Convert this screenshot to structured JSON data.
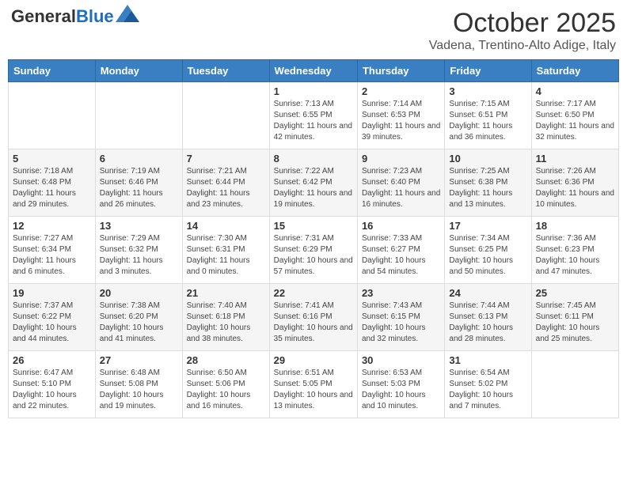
{
  "header": {
    "logo_general": "General",
    "logo_blue": "Blue",
    "month": "October 2025",
    "location": "Vadena, Trentino-Alto Adige, Italy"
  },
  "weekdays": [
    "Sunday",
    "Monday",
    "Tuesday",
    "Wednesday",
    "Thursday",
    "Friday",
    "Saturday"
  ],
  "weeks": [
    [
      {
        "day": "",
        "sunrise": "",
        "sunset": "",
        "daylight": ""
      },
      {
        "day": "",
        "sunrise": "",
        "sunset": "",
        "daylight": ""
      },
      {
        "day": "",
        "sunrise": "",
        "sunset": "",
        "daylight": ""
      },
      {
        "day": "1",
        "sunrise": "Sunrise: 7:13 AM",
        "sunset": "Sunset: 6:55 PM",
        "daylight": "Daylight: 11 hours and 42 minutes."
      },
      {
        "day": "2",
        "sunrise": "Sunrise: 7:14 AM",
        "sunset": "Sunset: 6:53 PM",
        "daylight": "Daylight: 11 hours and 39 minutes."
      },
      {
        "day": "3",
        "sunrise": "Sunrise: 7:15 AM",
        "sunset": "Sunset: 6:51 PM",
        "daylight": "Daylight: 11 hours and 36 minutes."
      },
      {
        "day": "4",
        "sunrise": "Sunrise: 7:17 AM",
        "sunset": "Sunset: 6:50 PM",
        "daylight": "Daylight: 11 hours and 32 minutes."
      }
    ],
    [
      {
        "day": "5",
        "sunrise": "Sunrise: 7:18 AM",
        "sunset": "Sunset: 6:48 PM",
        "daylight": "Daylight: 11 hours and 29 minutes."
      },
      {
        "day": "6",
        "sunrise": "Sunrise: 7:19 AM",
        "sunset": "Sunset: 6:46 PM",
        "daylight": "Daylight: 11 hours and 26 minutes."
      },
      {
        "day": "7",
        "sunrise": "Sunrise: 7:21 AM",
        "sunset": "Sunset: 6:44 PM",
        "daylight": "Daylight: 11 hours and 23 minutes."
      },
      {
        "day": "8",
        "sunrise": "Sunrise: 7:22 AM",
        "sunset": "Sunset: 6:42 PM",
        "daylight": "Daylight: 11 hours and 19 minutes."
      },
      {
        "day": "9",
        "sunrise": "Sunrise: 7:23 AM",
        "sunset": "Sunset: 6:40 PM",
        "daylight": "Daylight: 11 hours and 16 minutes."
      },
      {
        "day": "10",
        "sunrise": "Sunrise: 7:25 AM",
        "sunset": "Sunset: 6:38 PM",
        "daylight": "Daylight: 11 hours and 13 minutes."
      },
      {
        "day": "11",
        "sunrise": "Sunrise: 7:26 AM",
        "sunset": "Sunset: 6:36 PM",
        "daylight": "Daylight: 11 hours and 10 minutes."
      }
    ],
    [
      {
        "day": "12",
        "sunrise": "Sunrise: 7:27 AM",
        "sunset": "Sunset: 6:34 PM",
        "daylight": "Daylight: 11 hours and 6 minutes."
      },
      {
        "day": "13",
        "sunrise": "Sunrise: 7:29 AM",
        "sunset": "Sunset: 6:32 PM",
        "daylight": "Daylight: 11 hours and 3 minutes."
      },
      {
        "day": "14",
        "sunrise": "Sunrise: 7:30 AM",
        "sunset": "Sunset: 6:31 PM",
        "daylight": "Daylight: 11 hours and 0 minutes."
      },
      {
        "day": "15",
        "sunrise": "Sunrise: 7:31 AM",
        "sunset": "Sunset: 6:29 PM",
        "daylight": "Daylight: 10 hours and 57 minutes."
      },
      {
        "day": "16",
        "sunrise": "Sunrise: 7:33 AM",
        "sunset": "Sunset: 6:27 PM",
        "daylight": "Daylight: 10 hours and 54 minutes."
      },
      {
        "day": "17",
        "sunrise": "Sunrise: 7:34 AM",
        "sunset": "Sunset: 6:25 PM",
        "daylight": "Daylight: 10 hours and 50 minutes."
      },
      {
        "day": "18",
        "sunrise": "Sunrise: 7:36 AM",
        "sunset": "Sunset: 6:23 PM",
        "daylight": "Daylight: 10 hours and 47 minutes."
      }
    ],
    [
      {
        "day": "19",
        "sunrise": "Sunrise: 7:37 AM",
        "sunset": "Sunset: 6:22 PM",
        "daylight": "Daylight: 10 hours and 44 minutes."
      },
      {
        "day": "20",
        "sunrise": "Sunrise: 7:38 AM",
        "sunset": "Sunset: 6:20 PM",
        "daylight": "Daylight: 10 hours and 41 minutes."
      },
      {
        "day": "21",
        "sunrise": "Sunrise: 7:40 AM",
        "sunset": "Sunset: 6:18 PM",
        "daylight": "Daylight: 10 hours and 38 minutes."
      },
      {
        "day": "22",
        "sunrise": "Sunrise: 7:41 AM",
        "sunset": "Sunset: 6:16 PM",
        "daylight": "Daylight: 10 hours and 35 minutes."
      },
      {
        "day": "23",
        "sunrise": "Sunrise: 7:43 AM",
        "sunset": "Sunset: 6:15 PM",
        "daylight": "Daylight: 10 hours and 32 minutes."
      },
      {
        "day": "24",
        "sunrise": "Sunrise: 7:44 AM",
        "sunset": "Sunset: 6:13 PM",
        "daylight": "Daylight: 10 hours and 28 minutes."
      },
      {
        "day": "25",
        "sunrise": "Sunrise: 7:45 AM",
        "sunset": "Sunset: 6:11 PM",
        "daylight": "Daylight: 10 hours and 25 minutes."
      }
    ],
    [
      {
        "day": "26",
        "sunrise": "Sunrise: 6:47 AM",
        "sunset": "Sunset: 5:10 PM",
        "daylight": "Daylight: 10 hours and 22 minutes."
      },
      {
        "day": "27",
        "sunrise": "Sunrise: 6:48 AM",
        "sunset": "Sunset: 5:08 PM",
        "daylight": "Daylight: 10 hours and 19 minutes."
      },
      {
        "day": "28",
        "sunrise": "Sunrise: 6:50 AM",
        "sunset": "Sunset: 5:06 PM",
        "daylight": "Daylight: 10 hours and 16 minutes."
      },
      {
        "day": "29",
        "sunrise": "Sunrise: 6:51 AM",
        "sunset": "Sunset: 5:05 PM",
        "daylight": "Daylight: 10 hours and 13 minutes."
      },
      {
        "day": "30",
        "sunrise": "Sunrise: 6:53 AM",
        "sunset": "Sunset: 5:03 PM",
        "daylight": "Daylight: 10 hours and 10 minutes."
      },
      {
        "day": "31",
        "sunrise": "Sunrise: 6:54 AM",
        "sunset": "Sunset: 5:02 PM",
        "daylight": "Daylight: 10 hours and 7 minutes."
      },
      {
        "day": "",
        "sunrise": "",
        "sunset": "",
        "daylight": ""
      }
    ]
  ]
}
